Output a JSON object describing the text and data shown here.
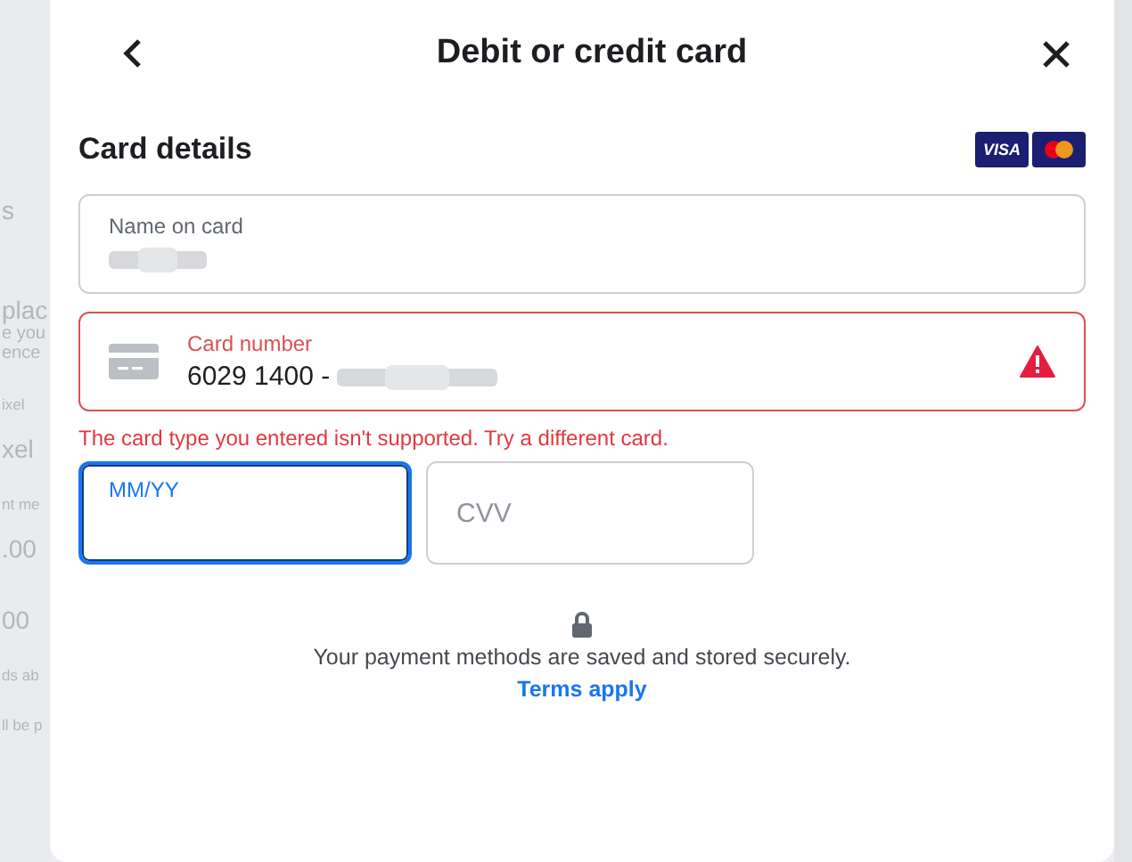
{
  "background_page": {
    "fragments": [
      {
        "kind": "heading",
        "text": "s"
      },
      {
        "kind": "heading",
        "text": "plac"
      },
      {
        "kind": "text",
        "text": "e you"
      },
      {
        "kind": "text",
        "text": "ence"
      },
      {
        "kind": "small",
        "text": "ixel"
      },
      {
        "kind": "heading",
        "text": "xel"
      },
      {
        "kind": "small",
        "text": "nt me"
      },
      {
        "kind": "heading",
        "text": ".00"
      },
      {
        "kind": "heading",
        "text": "00"
      },
      {
        "kind": "small",
        "text": "ds ab"
      },
      {
        "kind": "small",
        "text": "ll be p"
      }
    ]
  },
  "dialog": {
    "title": "Debit or credit card",
    "section_title": "Card details",
    "card_brands": [
      {
        "kind": "visa",
        "text": "VISA"
      },
      {
        "kind": "mastercard"
      }
    ],
    "fields": [
      {
        "kind": "name",
        "label": "Name on card",
        "redacted": true,
        "error": false
      },
      {
        "kind": "card_number",
        "label": "Card number",
        "value": "6029 1400 -",
        "redacted": true,
        "error": true
      }
    ],
    "error_message": "The card type you entered isn't supported. Try a different card.",
    "small_fields": [
      {
        "placeholder": "MM/YY",
        "focused": true
      },
      {
        "placeholder": "CVV",
        "focused": false
      }
    ],
    "note": "Your payment methods are saved and stored securely.",
    "link": "Terms apply"
  }
}
